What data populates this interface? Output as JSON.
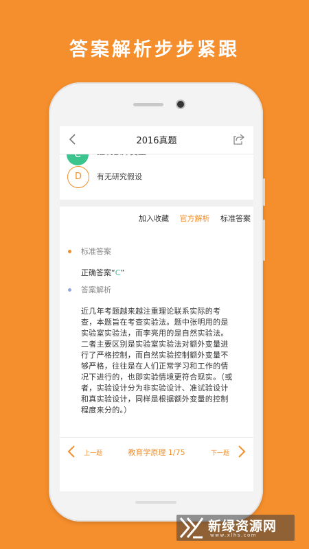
{
  "headline": "答案解析步步紧跟",
  "header": {
    "title": "2016真题"
  },
  "options": [
    {
      "letter": "C",
      "text": "控制额外变量"
    },
    {
      "letter": "D",
      "text": "有无研究假设"
    }
  ],
  "tabs": [
    "加入收藏",
    "官方解析",
    "标准答案"
  ],
  "standard_answer": {
    "title": "标准答案",
    "prefix": "正确答案“",
    "value": "C",
    "suffix": "”"
  },
  "analysis": {
    "title": "答案解析",
    "body": "近几年考题越来越注重理论联系实际的考查，本题旨在考查实验法。题中张明用的是实验室实验法，而李亮用的是自然实验法。二者主要区别是实验室实验法对额外变量进行了严格控制，而自然实验控制额外变量不够严格，往往是在人们正常学习和工作的情况下进行的，也即实验情境更符合现实。（或者，实验设计分为非实验设计、准试验设计和真实验设计，同样是根据额外变量的控制程度来分的。）"
  },
  "footer": {
    "prev": "上一题",
    "center": "教育学原理 1/75",
    "next": "下一题"
  },
  "watermark": {
    "title": "新绿资源网",
    "url": "www.xlhs.com"
  },
  "colors": {
    "accent": "#F08F2A",
    "green": "#3CC48F",
    "background": "#F58E2C"
  },
  "icons": [
    "back-arrow-icon",
    "share-icon",
    "chevron-left-icon",
    "chevron-right-icon"
  ]
}
